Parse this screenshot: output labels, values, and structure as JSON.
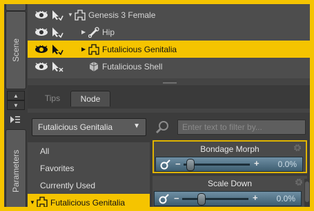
{
  "side_tabs": {
    "scene": "Scene",
    "parameters": "Parameters"
  },
  "scene_tree": [
    {
      "name": "Genesis 3 Female",
      "selected": false,
      "expand": "▼",
      "icon": "figure-icon"
    },
    {
      "name": "Hip",
      "selected": false,
      "expand": "▶",
      "icon": "bone-icon"
    },
    {
      "name": "Futalicious Genitalia",
      "selected": true,
      "expand": "▶",
      "icon": "figure-icon"
    },
    {
      "name": "Futalicious Shell",
      "selected": false,
      "expand": "",
      "icon": "shell-icon"
    }
  ],
  "tabs": {
    "tips": "Tips",
    "node": "Node"
  },
  "node_dropdown": {
    "selected": "Futalicious Genitalia",
    "arrow": "▼"
  },
  "param_groups": [
    {
      "label": "All",
      "selected": false
    },
    {
      "label": "Favorites",
      "selected": false
    },
    {
      "label": "Currently Used",
      "selected": false
    },
    {
      "label": "Futalicious Genitalia",
      "selected": true
    }
  ],
  "filter": {
    "placeholder": "Enter text to filter by..."
  },
  "sliders": [
    {
      "label": "Bondage Morph",
      "value": "0.0%",
      "level": 0.0
    },
    {
      "label": "Scale Down",
      "value": "0.0%",
      "level": 0.0
    }
  ],
  "colors": {
    "highlight": "#f5c400",
    "panel": "#505050",
    "slider": "#4f7184"
  }
}
